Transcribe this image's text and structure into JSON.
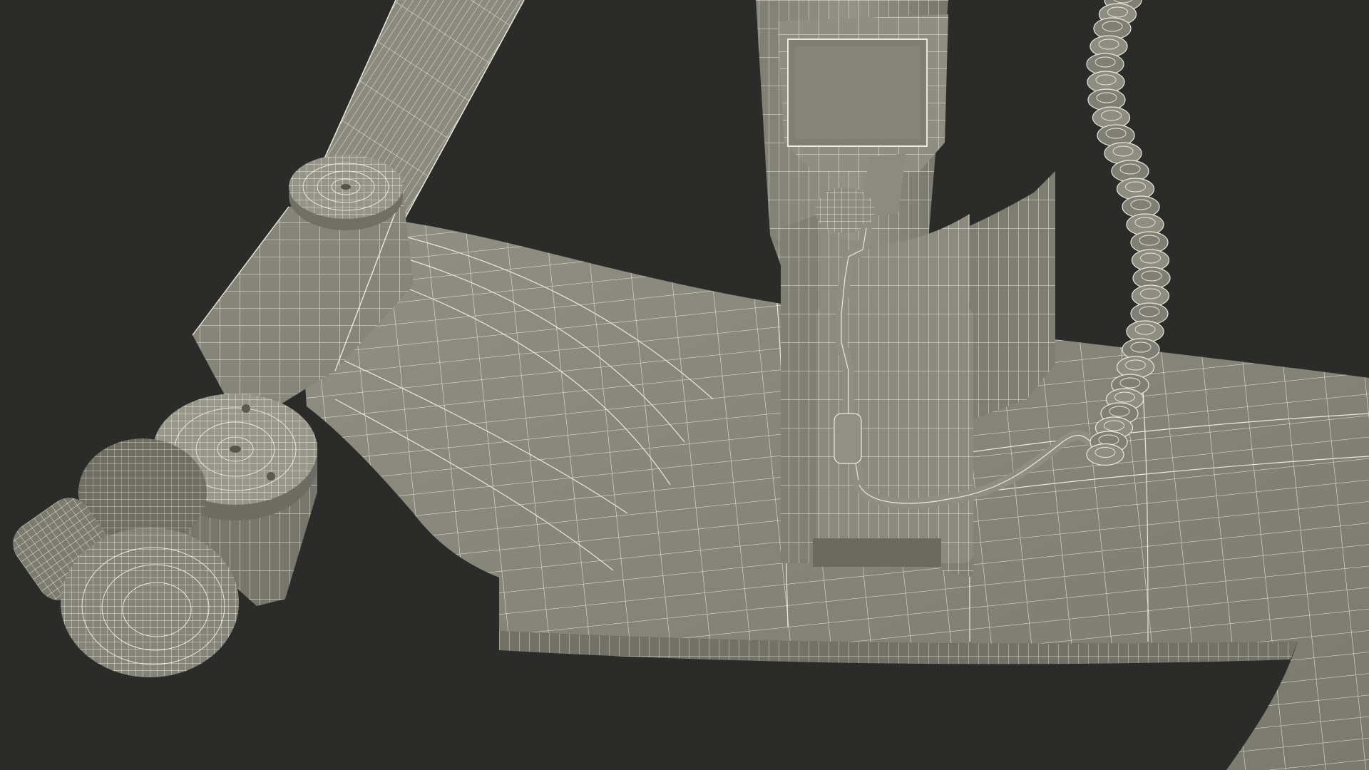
{
  "colors": {
    "background": "#2b2b29",
    "surface": "#8a8a7e",
    "surface_light": "#9d9d92",
    "surface_dark": "#6d6d63",
    "wire": "#e9e6d8"
  }
}
